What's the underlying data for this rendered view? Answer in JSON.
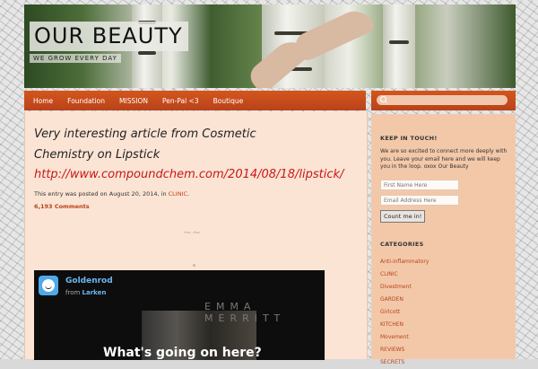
{
  "site": {
    "title": "OUR BEAUTY",
    "tagline": "WE GROW EVERY DAY"
  },
  "nav": {
    "items": [
      "Home",
      "Foundation",
      "MISSION",
      "Pen-Pal <3",
      "Boutique"
    ]
  },
  "post": {
    "title": "Very interesting article from Cosmetic Chemistry on Lipstick",
    "link": "http://www.compoundchem.com/2014/08/18/lipstick/",
    "meta_prefix": "This entry was posted on August 20, 2014, in",
    "meta_category": "CLINIC",
    "comments": "6,193 Comments"
  },
  "video": {
    "title": "Goldenrod",
    "from_label": "from",
    "from_author": "Larken",
    "overlay_text": "EMMA MERRITT",
    "caption": "What's going on here?"
  },
  "sidebar": {
    "search_placeholder": "",
    "keep_in_touch": {
      "title": "KEEP IN TOUCH!",
      "text": "We are so excited to connect more deeply with you.  Leave your email here and we will keep you in the loop. oxox Our Beauty",
      "first_name_placeholder": "First Name Here",
      "email_placeholder": "Email Address Here",
      "button": "Count me in!"
    },
    "categories": {
      "title": "CATEGORIES",
      "items": [
        "Anti-inflammatory",
        "CLINIC",
        "Divestment",
        "GARDEN",
        "Girlcott",
        "KITCHEN",
        "Movement",
        "REVIEWS",
        "SECRETS"
      ]
    }
  },
  "colors": {
    "accent": "#c84a1b",
    "main_bg": "#fbe4d4",
    "sidebar_bg": "#f3c8a9",
    "link_red": "#c81818"
  }
}
